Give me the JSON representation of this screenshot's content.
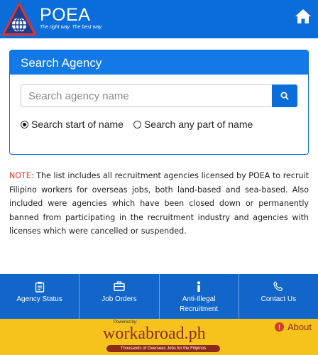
{
  "header": {
    "brand": "POEA",
    "tagline": "The right way. The best way."
  },
  "search_panel": {
    "title": "Search Agency",
    "placeholder": "Search agency name",
    "value": "",
    "options": [
      {
        "label": "Search start of name",
        "selected": true
      },
      {
        "label": "Search any part of name",
        "selected": false
      }
    ]
  },
  "note": {
    "label": "NOTE:",
    "text": " The list includes all recruitment agencies licensed by POEA to recruit Filipino workers for overseas jobs, both land-based and sea-based. Also included were agencies which have been closed down or permanently banned from participating in the recruitment industry and agencies with licenses which were cancelled or suspended."
  },
  "nav": [
    {
      "label": "Agency Status",
      "icon": "clipboard-icon"
    },
    {
      "label": "Job Orders",
      "icon": "briefcase-icon"
    },
    {
      "label": "Anti-Illegal Recruitment",
      "icon": "info-icon"
    },
    {
      "label": "Contact Us",
      "icon": "phone-icon"
    }
  ],
  "footer": {
    "powered_by": "Powered by:",
    "logo_text": "workabroad.ph",
    "logo_tagline": "Thousands of Overseas Jobs for the Filipinos",
    "about_label": "About"
  },
  "colors": {
    "header_blue": "#0a6dd9",
    "nav_blue": "#1266c9",
    "note_red": "#e53b2c",
    "footer_yellow": "#f6c21c"
  }
}
